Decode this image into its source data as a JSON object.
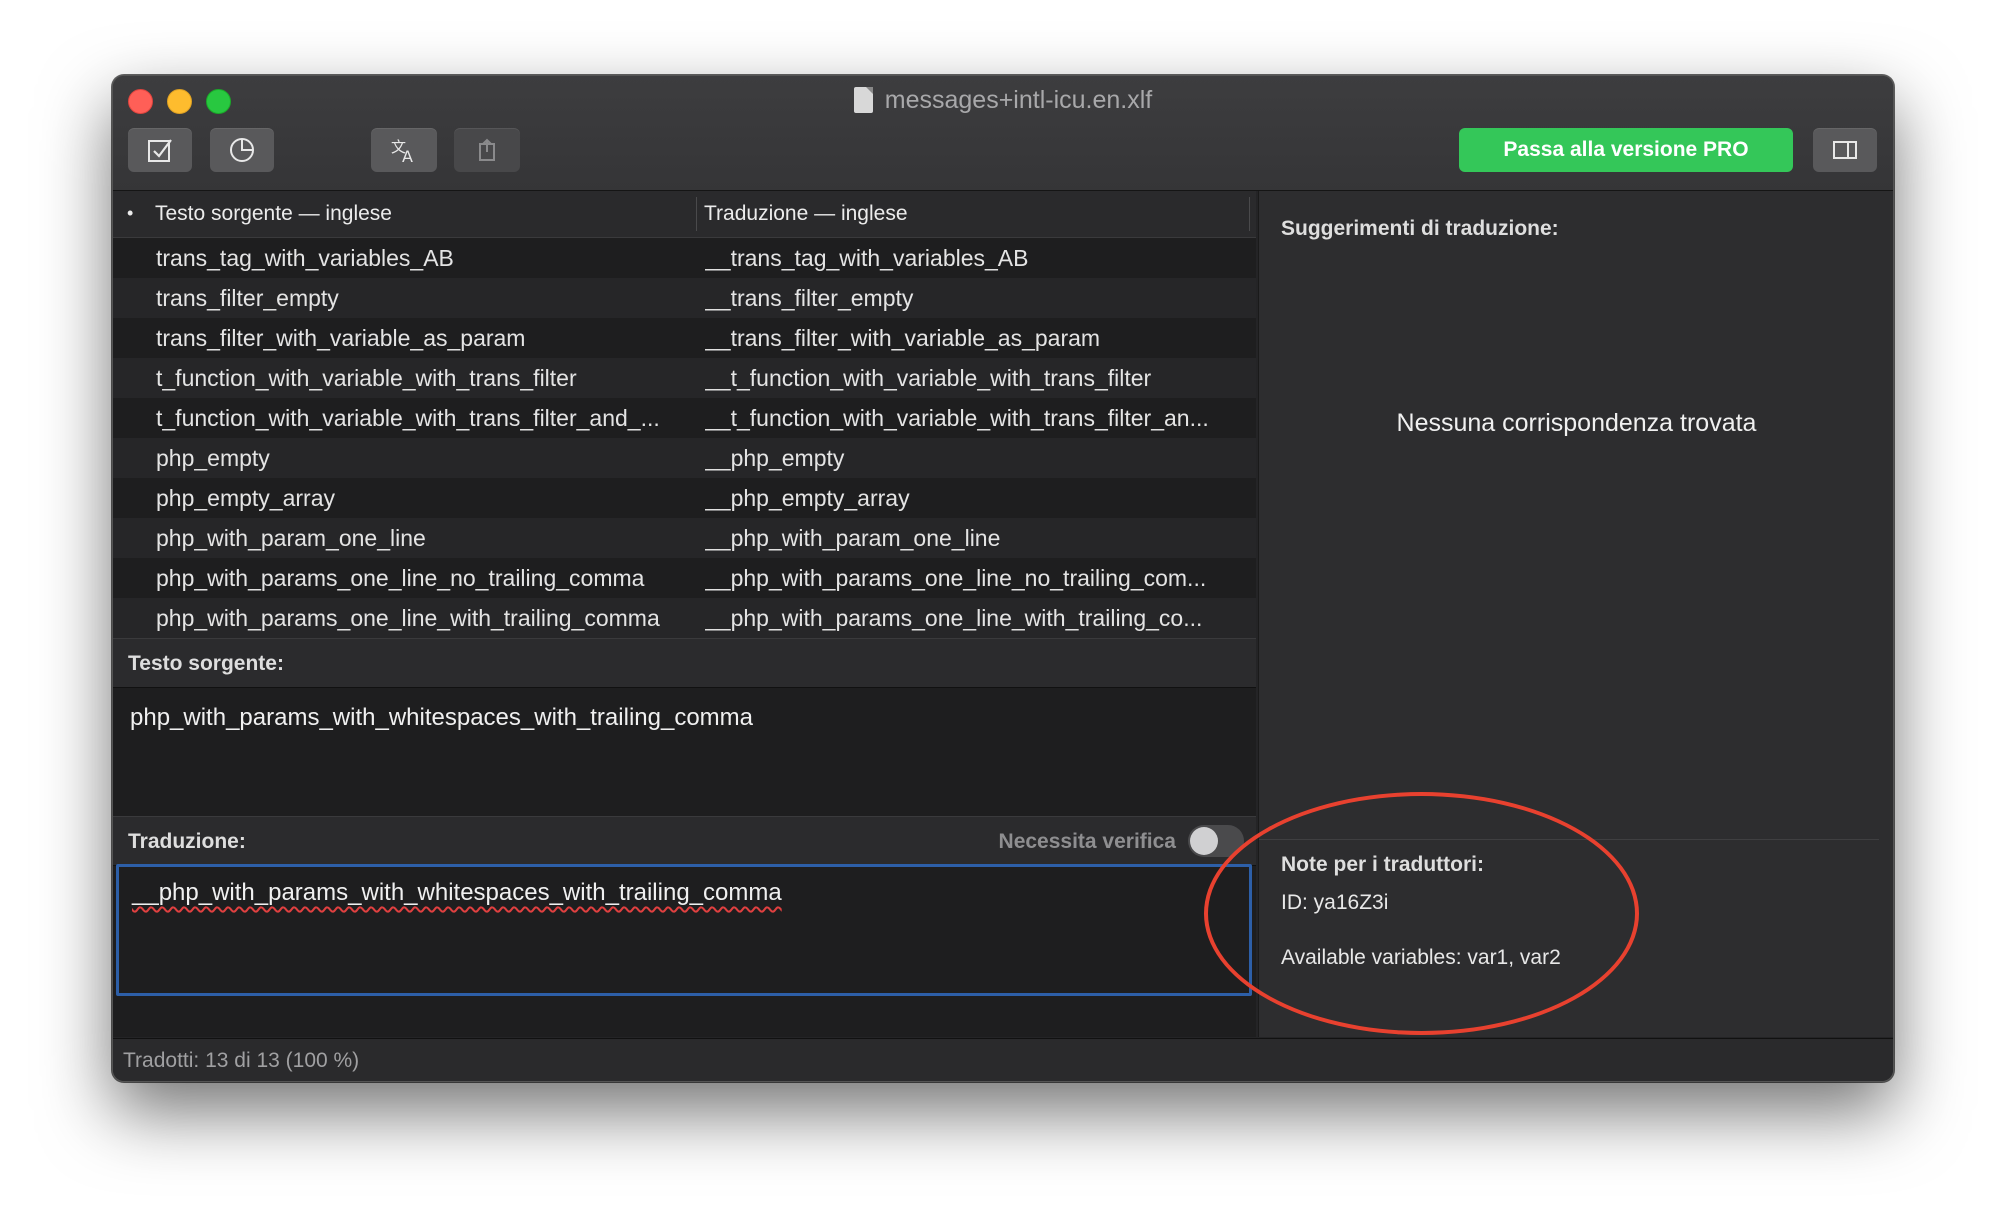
{
  "window": {
    "title": "messages+intl-icu.en.xlf"
  },
  "toolbar": {
    "buttons": [
      {
        "name": "checkmark-icon"
      },
      {
        "name": "clock-icon"
      },
      {
        "name": "translate-icon"
      },
      {
        "name": "export-icon"
      }
    ],
    "pro_label": "Passa alla versione PRO",
    "sidebar_toggle_icon": "sidebar-icon"
  },
  "table": {
    "headers": {
      "bullet": "•",
      "source": "Testo sorgente — inglese",
      "translation": "Traduzione — inglese"
    },
    "rows": [
      {
        "source": "trans_tag_with_variables_AB",
        "translation": "__trans_tag_with_variables_AB"
      },
      {
        "source": "trans_filter_empty",
        "translation": "__trans_filter_empty"
      },
      {
        "source": "trans_filter_with_variable_as_param",
        "translation": "__trans_filter_with_variable_as_param"
      },
      {
        "source": "t_function_with_variable_with_trans_filter",
        "translation": "__t_function_with_variable_with_trans_filter"
      },
      {
        "source": "t_function_with_variable_with_trans_filter_and_...",
        "translation": "__t_function_with_variable_with_trans_filter_an..."
      },
      {
        "source": "php_empty",
        "translation": "__php_empty"
      },
      {
        "source": "php_empty_array",
        "translation": "__php_empty_array"
      },
      {
        "source": "php_with_param_one_line",
        "translation": "__php_with_param_one_line"
      },
      {
        "source": "php_with_params_one_line_no_trailing_comma",
        "translation": "__php_with_params_one_line_no_trailing_com..."
      },
      {
        "source": "php_with_params_one_line_with_trailing_comma",
        "translation": "__php_with_params_one_line_with_trailing_co..."
      }
    ]
  },
  "source_section": {
    "label": "Testo sorgente:",
    "text": "php_with_params_with_whitespaces_with_trailing_comma"
  },
  "translation_section": {
    "label": "Traduzione:",
    "needs_review_label": "Necessita verifica",
    "needs_review_on": false,
    "value": "__php_with_params_with_whitespaces_with_trailing_comma"
  },
  "status": {
    "text": "Tradotti: 13 di 13 (100 %)"
  },
  "suggestions": {
    "title": "Suggerimenti di traduzione:",
    "empty_text": "Nessuna corrispondenza trovata"
  },
  "notes": {
    "title": "Note per i traduttori:",
    "id_line": "ID: ya16Z3i",
    "variables_line": "Available variables: var1, var2"
  },
  "colors": {
    "accent_green": "#34c759",
    "focus_blue": "#2d5fa8",
    "annotation_red": "#e8412f"
  }
}
